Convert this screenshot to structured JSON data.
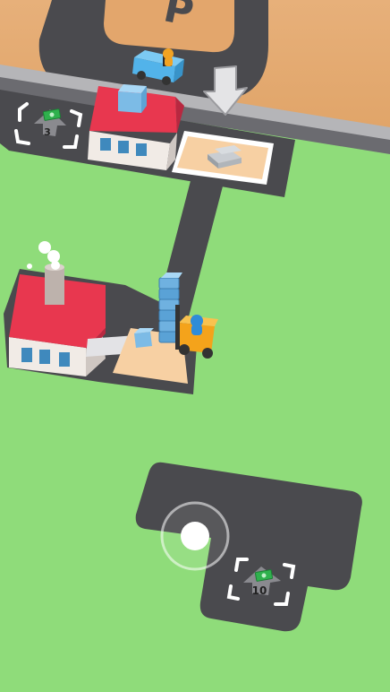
{
  "parking_sign": "P",
  "unlock_slots": [
    {
      "id": "top-left",
      "cost": "3"
    },
    {
      "id": "bottom-right",
      "cost": "10"
    }
  ],
  "colors": {
    "grass": "#8fdc7a",
    "sand": "#e5ad74",
    "asphalt": "#4a4a4e",
    "curb": "#b5b5b8",
    "roof": "#e8374f",
    "wall": "#f1ebe6",
    "window": "#3f89bd",
    "loading_pad": "#f7d0a3",
    "forklift": "#f4a31b",
    "worker": "#2f8cd8",
    "truck": "#52b3ea",
    "driver": "#f2a323",
    "crate": "#8fc8f0",
    "cash": "#2fb14d"
  },
  "icons": {
    "arrow": "down-arrow-icon",
    "cash": "cash-icon",
    "joystick": "joystick-icon"
  }
}
